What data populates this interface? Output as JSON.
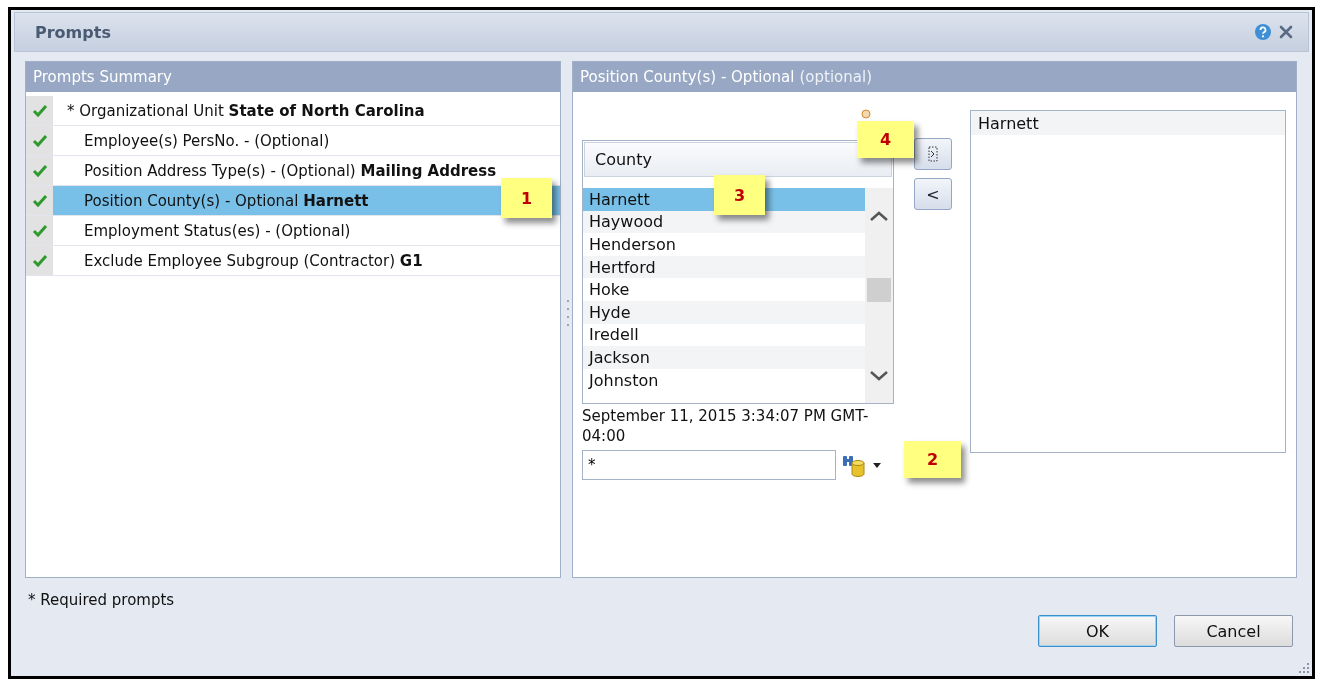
{
  "window": {
    "title": "Prompts"
  },
  "summary": {
    "title": "Prompts Summary",
    "rows": [
      {
        "text": "* Organizational Unit **State of North Carolina**",
        "required": true,
        "done": true,
        "selected": false
      },
      {
        "text": "Employee(s) PersNo. - (Optional)",
        "required": false,
        "done": true,
        "selected": false
      },
      {
        "text": "Position Address Type(s) - (Optional) **Mailing Address**",
        "required": false,
        "done": true,
        "selected": false
      },
      {
        "text": "Position County(s) - Optional **Harnett**",
        "required": false,
        "done": true,
        "selected": true
      },
      {
        "text": "Employment Status(es) - (Optional)",
        "required": false,
        "done": true,
        "selected": false
      },
      {
        "text": "Exclude Employee Subgroup (Contractor) **G1**",
        "required": false,
        "done": true,
        "selected": false
      }
    ]
  },
  "detail": {
    "title": "Position County(s) - Optional",
    "hint": "(optional)",
    "list": {
      "column": "County",
      "items": [
        {
          "label": "Harnett",
          "selected": true
        },
        {
          "label": "Haywood",
          "selected": false
        },
        {
          "label": "Henderson",
          "selected": false
        },
        {
          "label": "Hertford",
          "selected": false
        },
        {
          "label": "Hoke",
          "selected": false
        },
        {
          "label": "Hyde",
          "selected": false
        },
        {
          "label": "Iredell",
          "selected": false
        },
        {
          "label": "Jackson",
          "selected": false
        },
        {
          "label": "Johnston",
          "selected": false
        }
      ]
    },
    "remove_button": "<",
    "timestamp": "September 11, 2015 3:34:07 PM GMT-04:00",
    "search": {
      "value": "*"
    },
    "selected_values": [
      "Harnett"
    ]
  },
  "callouts": [
    {
      "label": "1"
    },
    {
      "label": "2"
    },
    {
      "label": "3"
    },
    {
      "label": "4"
    }
  ],
  "footnote": "* Required prompts",
  "buttons": [
    {
      "label": "OK",
      "default": true
    },
    {
      "label": "Cancel",
      "default": false
    }
  ]
}
